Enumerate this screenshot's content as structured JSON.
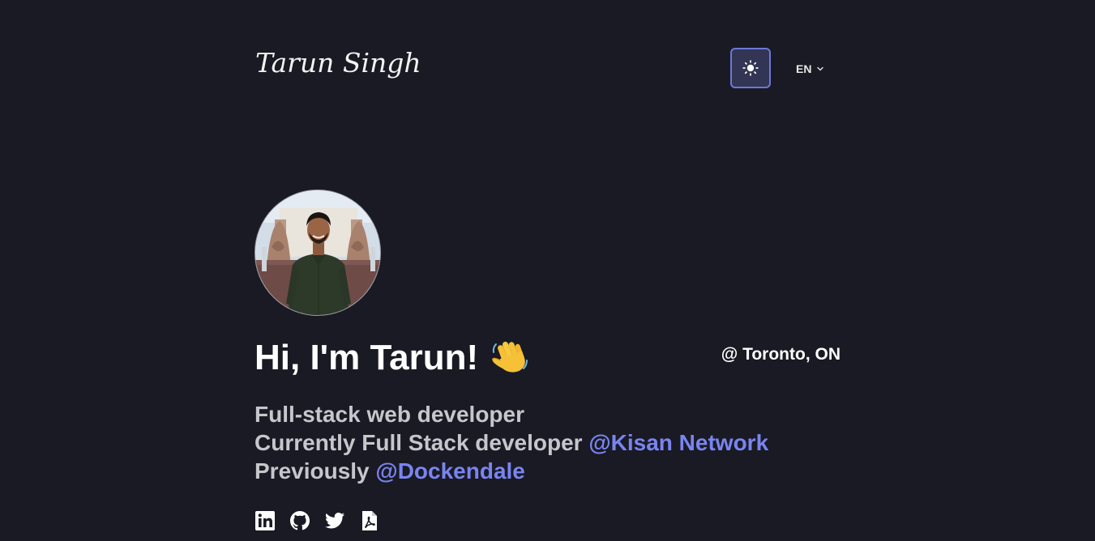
{
  "header": {
    "logo_text": "Tarun Singh",
    "theme_toggle": {
      "icon": "sun-icon"
    },
    "language": {
      "selected": "EN",
      "icon": "chevron-down-icon"
    }
  },
  "hero": {
    "avatar_alt": "Tarun Singh profile photo",
    "greeting": "Hi, I'm Tarun!",
    "greeting_emoji": "waving-hand-icon",
    "location": "@ Toronto, ON",
    "bio": {
      "line1": "Full-stack web developer",
      "line2_prefix": "Currently Full Stack developer ",
      "line2_link": "@Kisan Network",
      "line3_prefix": "Previously ",
      "line3_link": "@Dockendale"
    }
  },
  "socials": [
    {
      "name": "LinkedIn",
      "icon": "linkedin-icon"
    },
    {
      "name": "GitHub",
      "icon": "github-icon"
    },
    {
      "name": "Twitter",
      "icon": "twitter-icon"
    },
    {
      "name": "Resume PDF",
      "icon": "pdf-file-icon"
    }
  ],
  "colors": {
    "background": "#191a23",
    "accent": "#7a84f0",
    "toggle_border": "#6d78d8",
    "text_muted": "#c6c6cc"
  }
}
